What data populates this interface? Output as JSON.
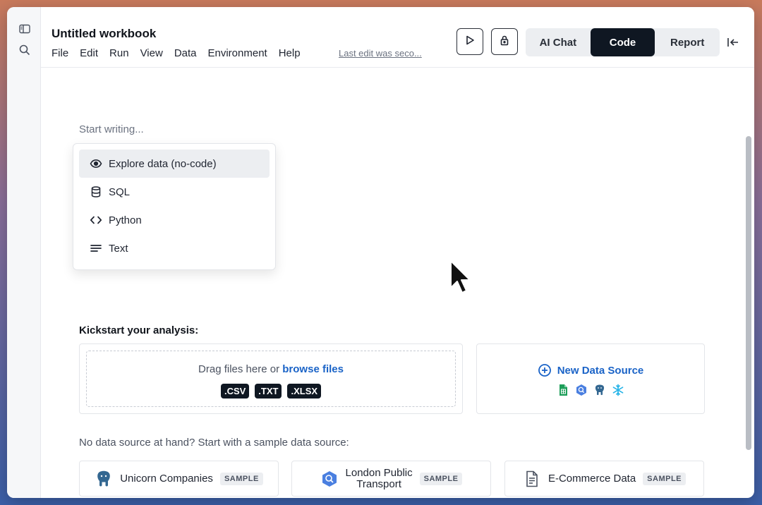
{
  "window": {
    "title": "Untitled workbook"
  },
  "menu": [
    "File",
    "Edit",
    "Run",
    "View",
    "Data",
    "Environment",
    "Help"
  ],
  "last_edit": "Last edit was seco...",
  "toolbar": {
    "run_icon": "play-icon",
    "lock_icon": "lock-icon"
  },
  "view_modes": [
    {
      "label": "AI Chat",
      "active": false
    },
    {
      "label": "Code",
      "active": true
    },
    {
      "label": "Report",
      "active": false
    }
  ],
  "editor": {
    "placeholder": "Start writing..."
  },
  "cell_menu": [
    {
      "label": "Explore data (no-code)",
      "icon": "eye-icon"
    },
    {
      "label": "SQL",
      "icon": "database-icon"
    },
    {
      "label": "Python",
      "icon": "code-icon"
    },
    {
      "label": "Text",
      "icon": "text-lines-icon"
    }
  ],
  "kickstart": {
    "heading": "Kickstart your analysis:",
    "drag_prefix": "Drag files here or",
    "browse_link": "browse files",
    "file_types": [
      ".CSV",
      ".TXT",
      ".XLSX"
    ],
    "new_source": "New Data Source"
  },
  "samples": {
    "intro": "No data source at hand? Start with a sample data source:",
    "tag": "SAMPLE",
    "items": [
      {
        "name": "Unicorn Companies",
        "icon": "postgres-icon"
      },
      {
        "name": "London Public\nTransport",
        "icon": "bigquery-icon"
      },
      {
        "name": "E-Commerce Data",
        "icon": "file-icon"
      }
    ]
  },
  "colors": {
    "accent": "#1a63c7",
    "dark": "#0f1722"
  }
}
